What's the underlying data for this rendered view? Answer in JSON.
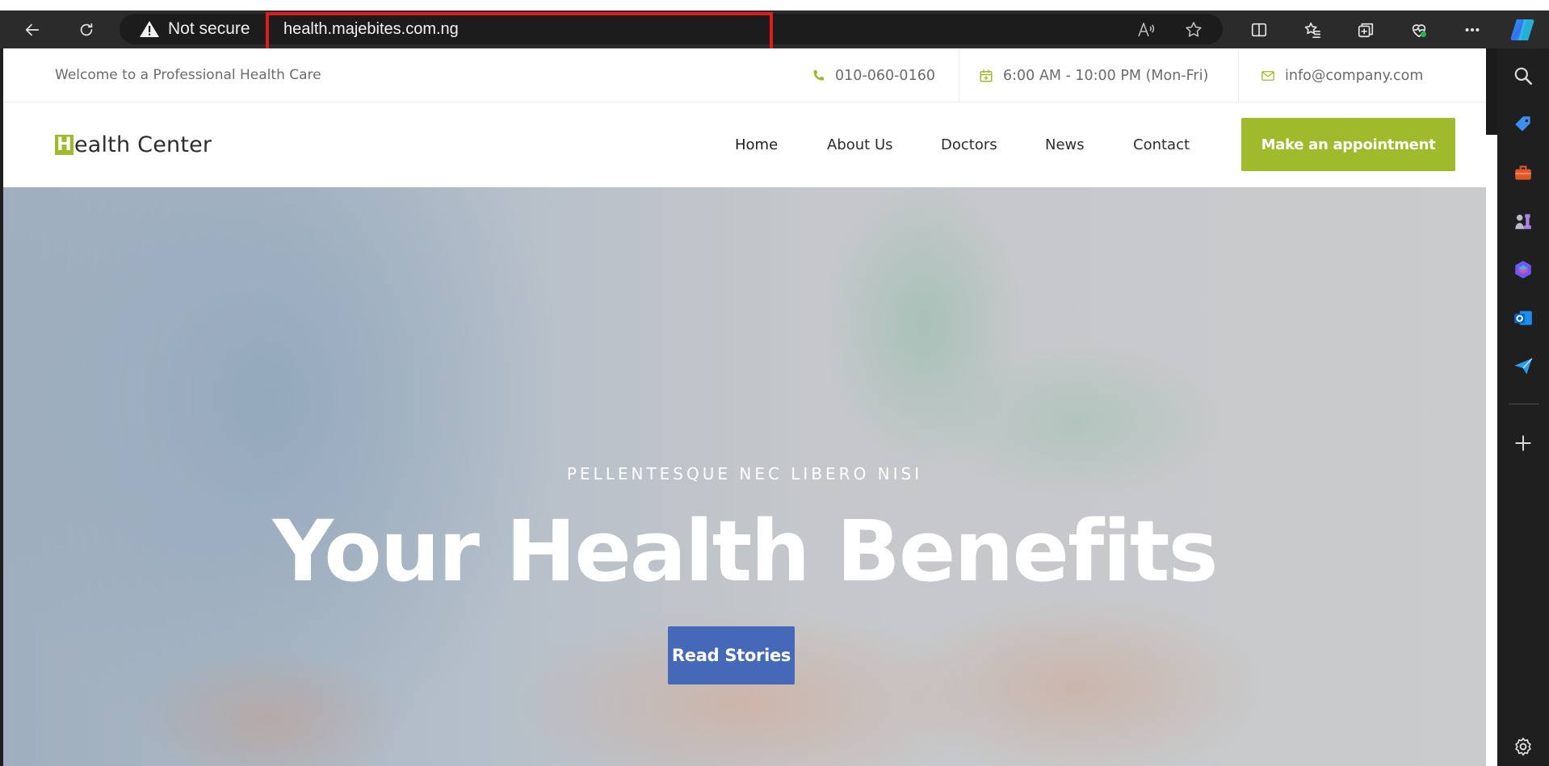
{
  "browser": {
    "security_label": "Not secure",
    "url": "health.majebites.com.ng",
    "toolbar_icons": [
      "back-icon",
      "refresh-icon",
      "read-aloud-icon",
      "favorite-star-icon",
      "split-screen-icon",
      "favorites-icon",
      "collections-icon",
      "browser-essentials-icon",
      "more-icon",
      "copilot-icon"
    ],
    "sidebar_icons": [
      "search-icon",
      "shopping-tag-icon",
      "tools-icon",
      "games-icon",
      "microsoft-365-icon",
      "outlook-icon",
      "send-icon",
      "add-icon",
      "settings-icon"
    ],
    "highlight_color": "#e01b1b"
  },
  "site": {
    "topbar": {
      "welcome": "Welcome to a Professional Health Care",
      "phone": "010-060-0160",
      "hours": "6:00 AM - 10:00 PM (Mon-Fri)",
      "email": "info@company.com"
    },
    "logo": {
      "initial": "H",
      "rest": "ealth Center"
    },
    "nav": {
      "home": "Home",
      "about": "About Us",
      "doctors": "Doctors",
      "news": "News",
      "contact": "Contact",
      "cta": "Make an appointment"
    },
    "hero": {
      "kicker": "PELLENTESQUE NEC LIBERO NISI",
      "title": "Your Health Benefits",
      "button": "Read Stories"
    },
    "colors": {
      "accent_green": "#9fba2a",
      "button_blue": "#4568b8",
      "text_dark": "#2d2d2d",
      "text_muted": "#6b6b6b"
    }
  }
}
